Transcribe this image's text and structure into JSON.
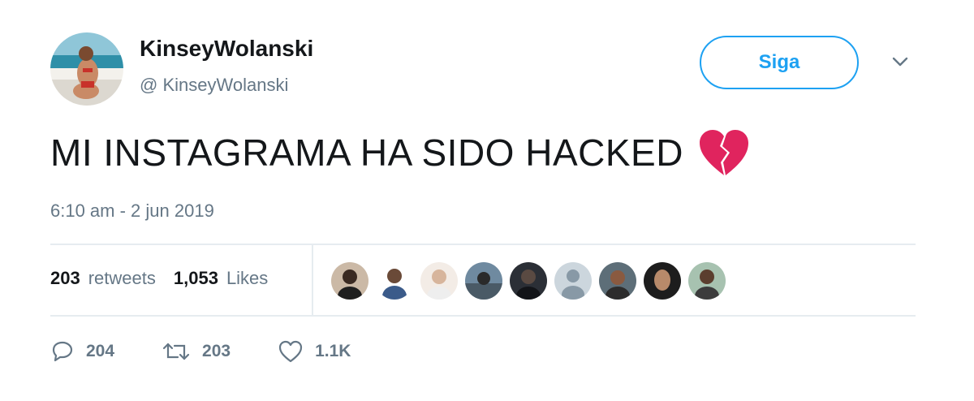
{
  "user": {
    "display_name": "KinseyWolanski",
    "handle": "@ KinseyWolanski"
  },
  "follow_button": {
    "label": "Siga"
  },
  "tweet": {
    "text": "MI INSTAGRAMA HA SIDO HACKED",
    "emoji": "broken-heart-icon",
    "timestamp": "6:10 am - 2 jun 2019"
  },
  "stats": {
    "retweets_count": "203",
    "retweets_label": "retweets",
    "likes_count": "1,053",
    "likes_label": "Likes"
  },
  "liker_avatars_count": 9,
  "actions": {
    "reply_count": "204",
    "retweet_count": "203",
    "like_count": "1.1K"
  },
  "colors": {
    "accent": "#1da1f2",
    "muted_text": "#657786",
    "primary_text": "#14171a",
    "divider": "#e6ecf0",
    "broken_heart": "#e0245e"
  }
}
